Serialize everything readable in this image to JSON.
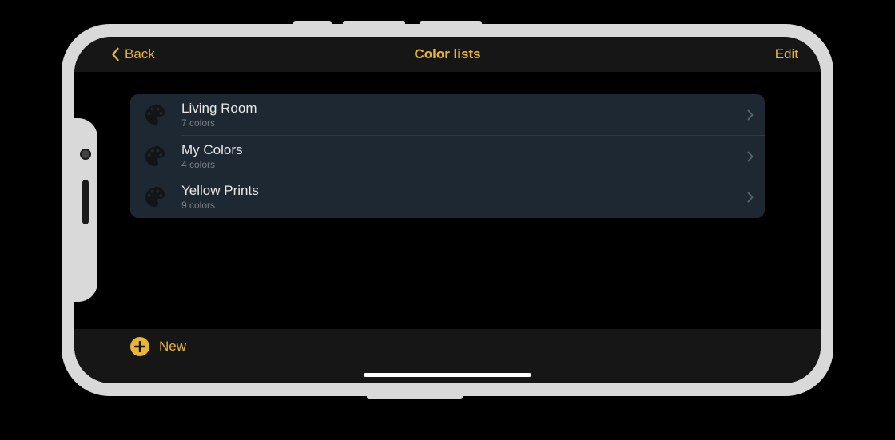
{
  "navbar": {
    "back_label": "Back",
    "title": "Color lists",
    "edit_label": "Edit"
  },
  "lists": [
    {
      "title": "Living Room",
      "subtitle": "7 colors"
    },
    {
      "title": "My Colors",
      "subtitle": "4 colors"
    },
    {
      "title": "Yellow Prints",
      "subtitle": "9 colors"
    }
  ],
  "toolbar": {
    "new_label": "New"
  },
  "colors": {
    "accent": "#eab52f",
    "list_bg": "#1e2832",
    "bar_bg": "#161616"
  }
}
